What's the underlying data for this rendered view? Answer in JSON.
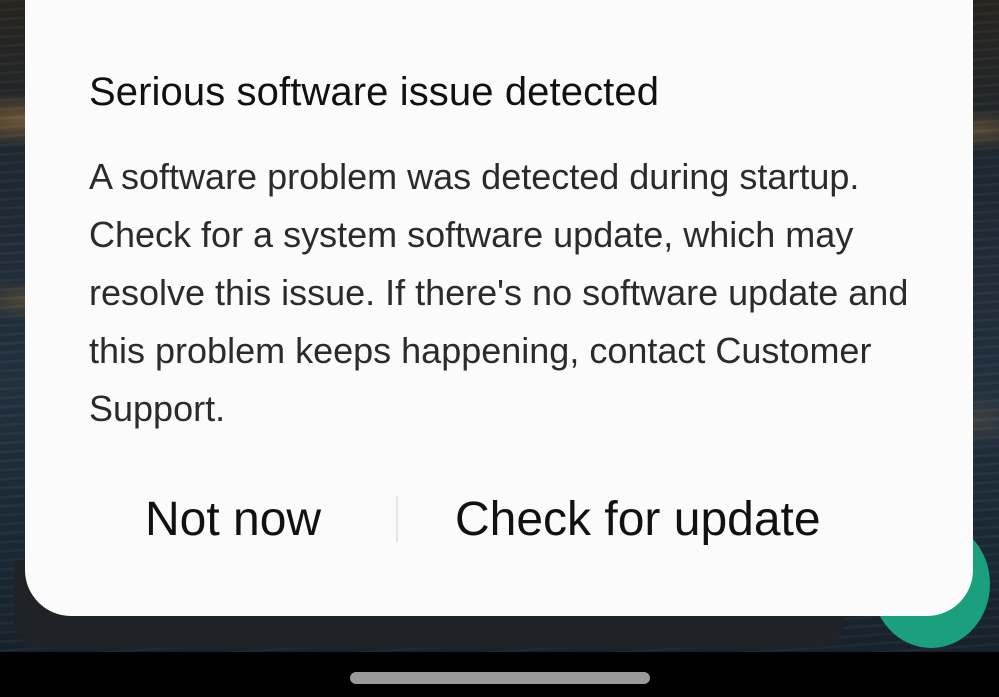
{
  "dialog": {
    "title": "Serious software issue detected",
    "message": "A software problem was detected during startup. Check for a system software update, which may resolve this issue. If there's no software update and this problem keeps happening, contact Customer Support.",
    "buttons": {
      "not_now": "Not now",
      "check_for_update": "Check for update"
    }
  },
  "colors": {
    "dialog_background": "#fbfbfb",
    "accent_green": "#1aa07c",
    "text_primary": "#111111",
    "nav_bar": "#000000"
  }
}
